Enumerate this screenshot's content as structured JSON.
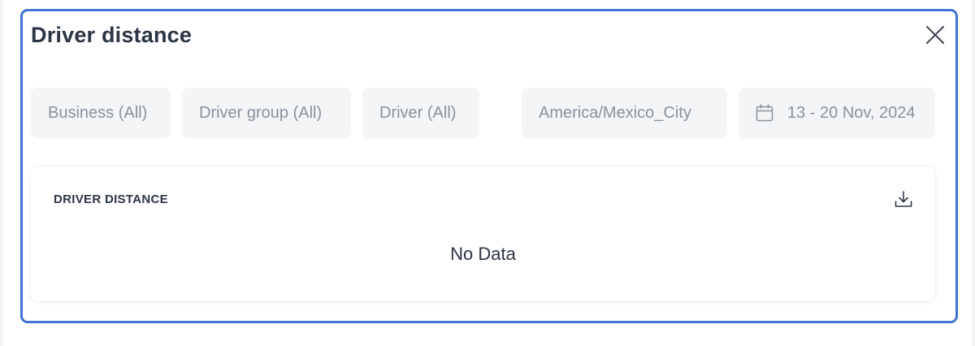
{
  "modal": {
    "title": "Driver distance",
    "close_icon": "close-icon",
    "border_color": "#3f74d1"
  },
  "filters": {
    "business": "Business (All)",
    "driver_group": "Driver group (All)",
    "driver": "Driver (All)",
    "timezone": "America/Mexico_City",
    "date_range": "13 - 20 Nov, 2024",
    "date_icon": "calendar-icon"
  },
  "card": {
    "title": "DRIVER DISTANCE",
    "download_icon": "download-icon",
    "empty_text": "No Data"
  }
}
